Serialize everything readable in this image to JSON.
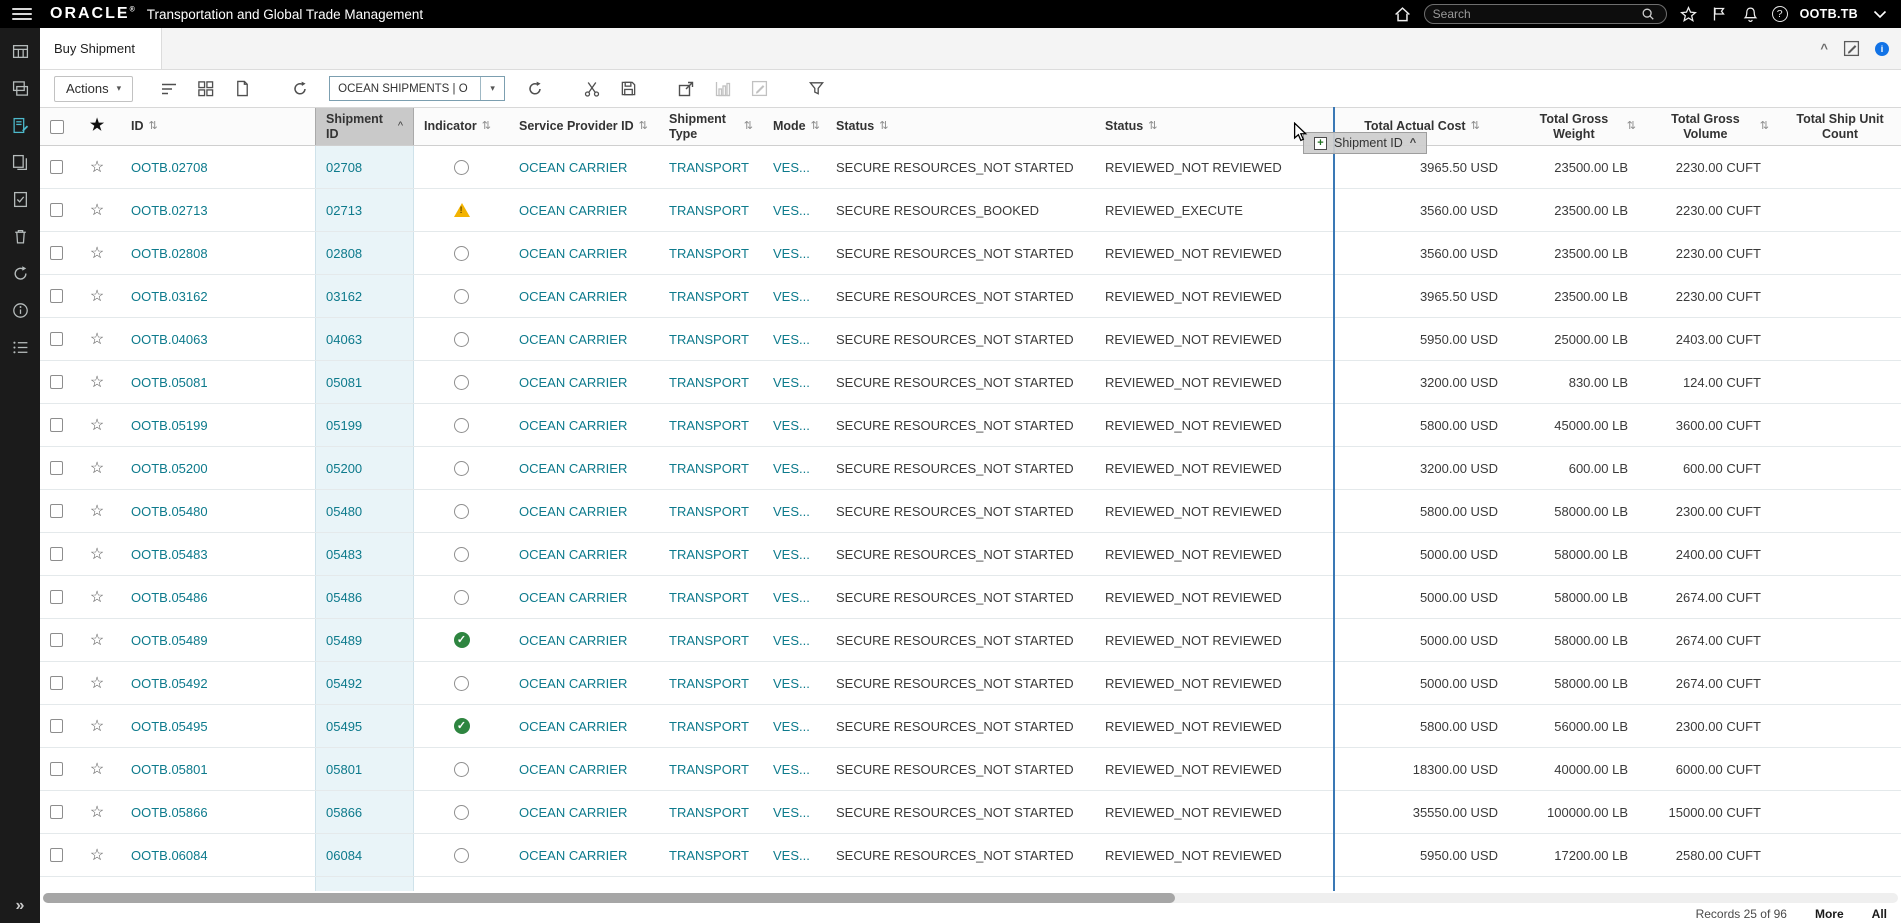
{
  "topbar": {
    "brand": "ORACLE",
    "brand_mark": "®",
    "app_title": "Transportation and Global Trade Management",
    "search_placeholder": "Search",
    "user": "OOTB.TB"
  },
  "tabbar": {
    "active_tab": "Buy Shipment"
  },
  "toolbar": {
    "actions_label": "Actions",
    "view_selector_value": "OCEAN SHIPMENTS | O"
  },
  "drag": {
    "ghost_label": "Shipment ID"
  },
  "table": {
    "columns": [
      {
        "key": "id",
        "label": "ID",
        "sort": "both"
      },
      {
        "key": "shipment_id",
        "label": "Shipment ID",
        "sort": "asc",
        "selected": true
      },
      {
        "key": "indicator",
        "label": "Indicator",
        "sort": "both"
      },
      {
        "key": "provider",
        "label": "Service Provider ID",
        "sort": "both"
      },
      {
        "key": "type",
        "label": "Shipment Type",
        "sort": "both"
      },
      {
        "key": "mode",
        "label": "Mode",
        "sort": "both"
      },
      {
        "key": "status1",
        "label": "Status",
        "sort": "both"
      },
      {
        "key": "status2",
        "label": "Status",
        "sort": "both"
      },
      {
        "key": "cost",
        "label": "Total Actual Cost",
        "sort": "both",
        "align": "right"
      },
      {
        "key": "weight",
        "label": "Total Gross Weight",
        "sort": "both",
        "align": "right"
      },
      {
        "key": "volume",
        "label": "Total Gross Volume",
        "sort": "both",
        "align": "right"
      },
      {
        "key": "ship_unit_count",
        "label": "Total Ship Unit Count",
        "sort": "none",
        "align": "right"
      }
    ],
    "rows": [
      {
        "id": "OOTB.02708",
        "shipment_id": "02708",
        "indicator": "none",
        "provider": "OCEAN CARRIER",
        "type": "TRANSPORT",
        "mode": "VES...",
        "status1": "SECURE RESOURCES_NOT STARTED",
        "status2": "REVIEWED_NOT REVIEWED",
        "cost": "3965.50 USD",
        "weight": "23500.00 LB",
        "volume": "2230.00 CUFT"
      },
      {
        "id": "OOTB.02713",
        "shipment_id": "02713",
        "indicator": "warning",
        "provider": "OCEAN CARRIER",
        "type": "TRANSPORT",
        "mode": "VES...",
        "status1": "SECURE RESOURCES_BOOKED",
        "status2": "REVIEWED_EXECUTE",
        "cost": "3560.00 USD",
        "weight": "23500.00 LB",
        "volume": "2230.00 CUFT"
      },
      {
        "id": "OOTB.02808",
        "shipment_id": "02808",
        "indicator": "none",
        "provider": "OCEAN CARRIER",
        "type": "TRANSPORT",
        "mode": "VES...",
        "status1": "SECURE RESOURCES_NOT STARTED",
        "status2": "REVIEWED_NOT REVIEWED",
        "cost": "3560.00 USD",
        "weight": "23500.00 LB",
        "volume": "2230.00 CUFT"
      },
      {
        "id": "OOTB.03162",
        "shipment_id": "03162",
        "indicator": "none",
        "provider": "OCEAN CARRIER",
        "type": "TRANSPORT",
        "mode": "VES...",
        "status1": "SECURE RESOURCES_NOT STARTED",
        "status2": "REVIEWED_NOT REVIEWED",
        "cost": "3965.50 USD",
        "weight": "23500.00 LB",
        "volume": "2230.00 CUFT"
      },
      {
        "id": "OOTB.04063",
        "shipment_id": "04063",
        "indicator": "none",
        "provider": "OCEAN CARRIER",
        "type": "TRANSPORT",
        "mode": "VES...",
        "status1": "SECURE RESOURCES_NOT STARTED",
        "status2": "REVIEWED_NOT REVIEWED",
        "cost": "5950.00 USD",
        "weight": "25000.00 LB",
        "volume": "2403.00 CUFT"
      },
      {
        "id": "OOTB.05081",
        "shipment_id": "05081",
        "indicator": "none",
        "provider": "OCEAN CARRIER",
        "type": "TRANSPORT",
        "mode": "VES...",
        "status1": "SECURE RESOURCES_NOT STARTED",
        "status2": "REVIEWED_NOT REVIEWED",
        "cost": "3200.00 USD",
        "weight": "830.00 LB",
        "volume": "124.00 CUFT"
      },
      {
        "id": "OOTB.05199",
        "shipment_id": "05199",
        "indicator": "none",
        "provider": "OCEAN CARRIER",
        "type": "TRANSPORT",
        "mode": "VES...",
        "status1": "SECURE RESOURCES_NOT STARTED",
        "status2": "REVIEWED_NOT REVIEWED",
        "cost": "5800.00 USD",
        "weight": "45000.00 LB",
        "volume": "3600.00 CUFT"
      },
      {
        "id": "OOTB.05200",
        "shipment_id": "05200",
        "indicator": "none",
        "provider": "OCEAN CARRIER",
        "type": "TRANSPORT",
        "mode": "VES...",
        "status1": "SECURE RESOURCES_NOT STARTED",
        "status2": "REVIEWED_NOT REVIEWED",
        "cost": "3200.00 USD",
        "weight": "600.00 LB",
        "volume": "600.00 CUFT"
      },
      {
        "id": "OOTB.05480",
        "shipment_id": "05480",
        "indicator": "none",
        "provider": "OCEAN CARRIER",
        "type": "TRANSPORT",
        "mode": "VES...",
        "status1": "SECURE RESOURCES_NOT STARTED",
        "status2": "REVIEWED_NOT REVIEWED",
        "cost": "5800.00 USD",
        "weight": "58000.00 LB",
        "volume": "2300.00 CUFT"
      },
      {
        "id": "OOTB.05483",
        "shipment_id": "05483",
        "indicator": "none",
        "provider": "OCEAN CARRIER",
        "type": "TRANSPORT",
        "mode": "VES...",
        "status1": "SECURE RESOURCES_NOT STARTED",
        "status2": "REVIEWED_NOT REVIEWED",
        "cost": "5000.00 USD",
        "weight": "58000.00 LB",
        "volume": "2400.00 CUFT"
      },
      {
        "id": "OOTB.05486",
        "shipment_id": "05486",
        "indicator": "none",
        "provider": "OCEAN CARRIER",
        "type": "TRANSPORT",
        "mode": "VES...",
        "status1": "SECURE RESOURCES_NOT STARTED",
        "status2": "REVIEWED_NOT REVIEWED",
        "cost": "5000.00 USD",
        "weight": "58000.00 LB",
        "volume": "2674.00 CUFT"
      },
      {
        "id": "OOTB.05489",
        "shipment_id": "05489",
        "indicator": "check",
        "provider": "OCEAN CARRIER",
        "type": "TRANSPORT",
        "mode": "VES...",
        "status1": "SECURE RESOURCES_NOT STARTED",
        "status2": "REVIEWED_NOT REVIEWED",
        "cost": "5000.00 USD",
        "weight": "58000.00 LB",
        "volume": "2674.00 CUFT"
      },
      {
        "id": "OOTB.05492",
        "shipment_id": "05492",
        "indicator": "none",
        "provider": "OCEAN CARRIER",
        "type": "TRANSPORT",
        "mode": "VES...",
        "status1": "SECURE RESOURCES_NOT STARTED",
        "status2": "REVIEWED_NOT REVIEWED",
        "cost": "5000.00 USD",
        "weight": "58000.00 LB",
        "volume": "2674.00 CUFT"
      },
      {
        "id": "OOTB.05495",
        "shipment_id": "05495",
        "indicator": "check",
        "provider": "OCEAN CARRIER",
        "type": "TRANSPORT",
        "mode": "VES...",
        "status1": "SECURE RESOURCES_NOT STARTED",
        "status2": "REVIEWED_NOT REVIEWED",
        "cost": "5800.00 USD",
        "weight": "56000.00 LB",
        "volume": "2300.00 CUFT"
      },
      {
        "id": "OOTB.05801",
        "shipment_id": "05801",
        "indicator": "none",
        "provider": "OCEAN CARRIER",
        "type": "TRANSPORT",
        "mode": "VES...",
        "status1": "SECURE RESOURCES_NOT STARTED",
        "status2": "REVIEWED_NOT REVIEWED",
        "cost": "18300.00 USD",
        "weight": "40000.00 LB",
        "volume": "6000.00 CUFT"
      },
      {
        "id": "OOTB.05866",
        "shipment_id": "05866",
        "indicator": "none",
        "provider": "OCEAN CARRIER",
        "type": "TRANSPORT",
        "mode": "VES...",
        "status1": "SECURE RESOURCES_NOT STARTED",
        "status2": "REVIEWED_NOT REVIEWED",
        "cost": "35550.00 USD",
        "weight": "100000.00 LB",
        "volume": "15000.00 CUFT"
      },
      {
        "id": "OOTB.06084",
        "shipment_id": "06084",
        "indicator": "none",
        "provider": "OCEAN CARRIER",
        "type": "TRANSPORT",
        "mode": "VES...",
        "status1": "SECURE RESOURCES_NOT STARTED",
        "status2": "REVIEWED_NOT REVIEWED",
        "cost": "5950.00 USD",
        "weight": "17200.00 LB",
        "volume": "2580.00 CUFT"
      }
    ]
  },
  "footer": {
    "records": "Records 25 of 96",
    "more_label": "More",
    "all_label": "All"
  },
  "icons": {
    "sort_both": "⇅",
    "sort_asc": "^",
    "favorite_on": "★",
    "favorite_off": "☆",
    "chevron_down": "▾",
    "check": "✓",
    "warning_bang": "!",
    "plus": "+",
    "collapse_caret": "^",
    "expand_double": "»",
    "help": "?",
    "info_badge": "i"
  }
}
